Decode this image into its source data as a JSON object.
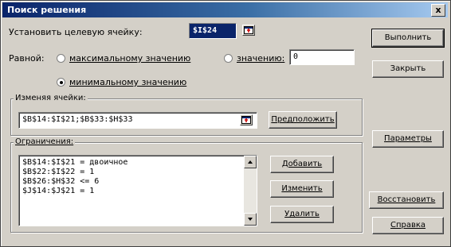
{
  "window": {
    "title": "Поиск решения",
    "close_label": "x"
  },
  "target": {
    "label": "Установить целевую ячейку:",
    "value": "$I$24"
  },
  "equal": {
    "label": "Равной:",
    "max_label": "максимальному значению",
    "value_label": "значению:",
    "value_field": "0",
    "min_label": "минимальному значению"
  },
  "changing": {
    "label": "Изменяя ячейки:",
    "value": "$B$14:$I$21;$B$33:$H$33",
    "guess_label": "Предположить"
  },
  "constraints": {
    "label": "Ограничения:",
    "items": [
      "$B$14:$I$21 = двоичное",
      "$B$22:$I$22 = 1",
      "$B$26:$H$32 <= 6",
      "$J$14:$J$21 = 1"
    ],
    "add_label": "Добавить",
    "change_label": "Изменить",
    "delete_label": "Удалить"
  },
  "buttons": {
    "solve": "Выполнить",
    "close": "Закрыть",
    "options": "Параметры",
    "reset": "Восстановить",
    "help": "Справка"
  }
}
